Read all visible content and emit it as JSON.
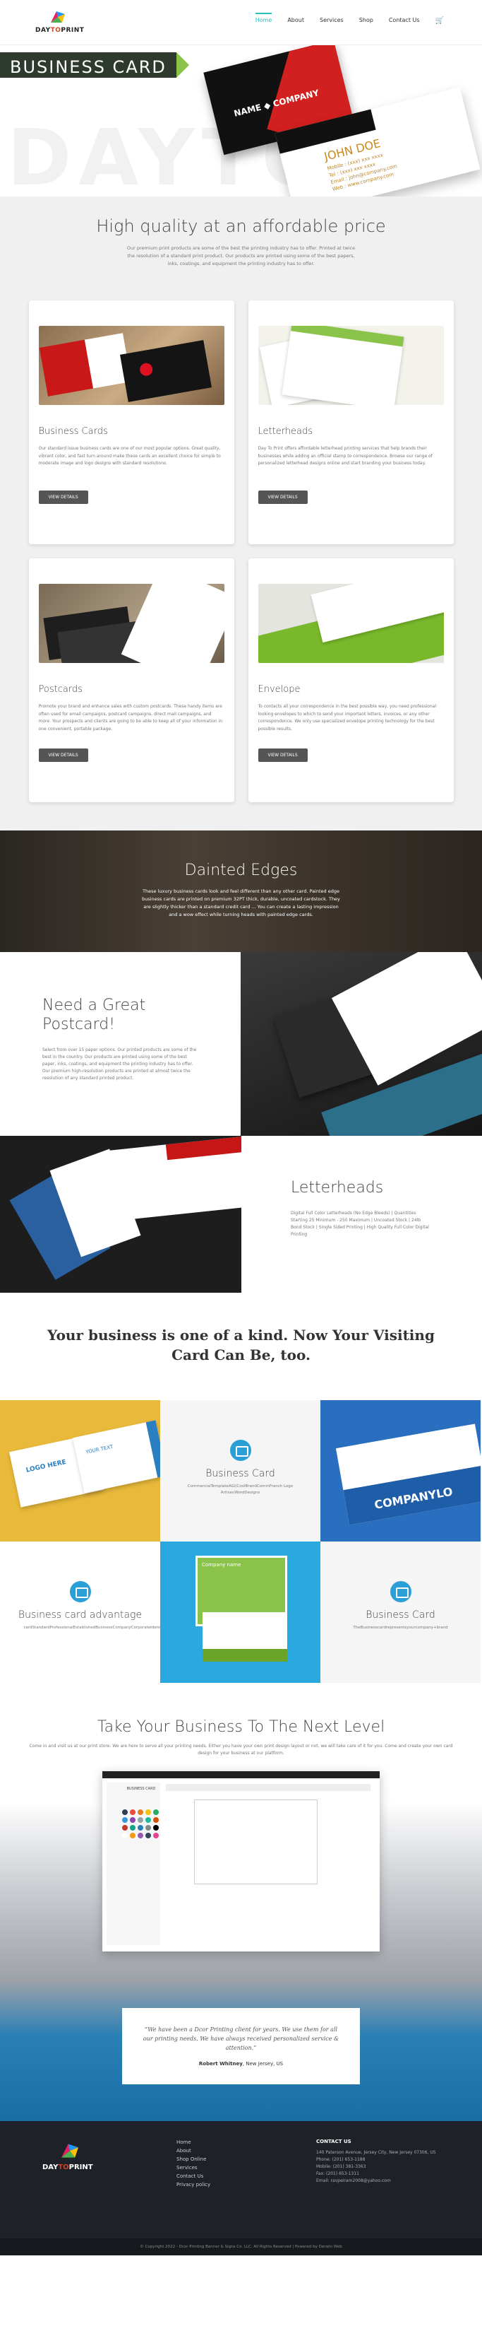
{
  "header": {
    "logo_a": "DAY",
    "logo_b": "TO",
    "logo_c": "PRINT",
    "nav": [
      "Home",
      "About",
      "Services",
      "Shop",
      "Contact Us"
    ],
    "cart_icon": "cart-icon"
  },
  "hero": {
    "title": "BUSINESS CARD",
    "ghost": "DAYTO",
    "card_name_1": "NAME ◆ COMPANY",
    "card_name_2": "JOHN DOE",
    "card_details": "Mobile : (xxx) xxx xxxx\nTel : (xxx) xxx xxxx\nEmail : john@company.com\nWeb : www.company.com"
  },
  "intro": {
    "heading": "High quality at an affordable price",
    "text": "Our premium print products are some of the best the printing industry has to offer. Printed at twice the resolution of a standard print product. Our products are printed using some of the best papers, inks, coatings, and equipment the printing industry has to offer."
  },
  "products": [
    {
      "title": "Business Cards",
      "text": "Our standard issue business cards are one of our most popular options. Great quality, vibrant color, and fast turn around make these cards an excellent choice for simple to moderate image and logo designs with standard resolutions.",
      "button": "VIEW DETAILS"
    },
    {
      "title": "Letterheads",
      "text": "Day To Print offers affordable letterhead printing services that help brands their businesses while adding an official stamp to correspondence. Browse our range of personalized letterhead designs online and start branding your business today.",
      "button": "VIEW DETAILS"
    },
    {
      "title": "Postcards",
      "text": "Promote your brand and enhance sales with custom postcards. These handy items are often used for email campaigns, postcard campaigns, direct mail campaigns, and more. Your prospects and clients are going to be able to keep all of your information in one convenient, portable package.",
      "button": "VIEW DETAILS"
    },
    {
      "title": "Envelope",
      "text": "To contacts all your correspondence in the best possible way, you need professional looking envelopes to which to send your important letters, invoices, or any other correspondence. We only use specialized envelope printing technology for the best possible results.",
      "button": "VIEW DETAILS"
    }
  ],
  "dark_banner": {
    "heading": "Dainted Edges",
    "text": "These luxury business cards look and feel different than any other card. Painted edge business cards are printed on premium 32PT thick, durable, uncoated cardstock. They are slightly thicker than a standard credit card ... You can create a lasting impression and a wow effect while turning heads with painted edge cards."
  },
  "postcard_section": {
    "heading": "Need a Great Postcard!",
    "text": "Select from over 15 paper options. Our printed products are some of the best in the country. Our products are printed using some of the best paper, inks, coatings, and equipment the printing industry has to offer. Our premium high-resolution products are printed at almost twice the resolution of any standard printed product."
  },
  "letterhead_section": {
    "heading": "Letterheads",
    "text": "Digital Full Color Letterheads (No Edge Bleeds) | Quantities Starting 25 Minimum - 250 Maximum | Uncoated Stock | 24lb Bond Stock | Single Sided Printing | High Quality Full Color Digital Printing"
  },
  "headline": "Your business is one of a kind. Now Your Visiting Card Can Be, too.",
  "grid": {
    "card1_title": "Business Card",
    "card1_text": "CommercialTemplateAGi(CoolBrandCommFranch Logo ArtisanWordDesigns",
    "advantage_title": "Business card advantage",
    "advantage_text": "cardStandardProfessionalEstablishedBusinessCompanyCorporateIdentityValue",
    "card2_title": "Business Card",
    "card2_text": "TheBusinesscardrepresentsyourcompany+brand",
    "logo_here": "LOGO HERE",
    "your_text": "YOUR TEXT",
    "company_logo": "COMPANYLO",
    "company_name": "Company name"
  },
  "next_level": {
    "heading": "Take Your Business To The Next Level",
    "text": "Come in and visit us at our print store. We are here to serve all your printing needs. Either you have your own print design layout or not, we will take care of it for you. Come and create your own card design for your business at our platform.",
    "editor_tab": "BUSINESS CARD",
    "swatch_colors": [
      "#2c3e50",
      "#e74c3c",
      "#e67e22",
      "#f1c40f",
      "#27ae60",
      "#3498db",
      "#8e44ad",
      "#95a5a6",
      "#1abc9c",
      "#d35400",
      "#c0392b",
      "#16a085",
      "#2980b9",
      "#7f8c8d",
      "#000000",
      "#ffffff",
      "#f39c12",
      "#9b59b6",
      "#34495e",
      "#e84393"
    ]
  },
  "testimonial": {
    "quote": "We have been a Dcor Printing client for years. We use them for all our printing needs. We have always received personalized service & attention.",
    "author": "Robert Whitney",
    "location": "New Jersey, US"
  },
  "footer": {
    "links": [
      "Home",
      "About",
      "Shop Online",
      "Services",
      "Contact Us",
      "Privacy policy"
    ],
    "contact_heading": "CONTACT US",
    "address": "140 Paterson Avenue, Jersey City, New Jersey 07306, US",
    "phone": "Phone: (201) 653-1188",
    "mobile": "Mobile: (201) 381-3363",
    "fax": "Fax: (201) 653-1311",
    "email": "Email: ravpeiram2008@yahoo.com",
    "copyright": "© Copyright 2022 - Dcor Printing Banner & Signs Co. LLC. All Rights Reserved | Powered by Derwin Web"
  }
}
